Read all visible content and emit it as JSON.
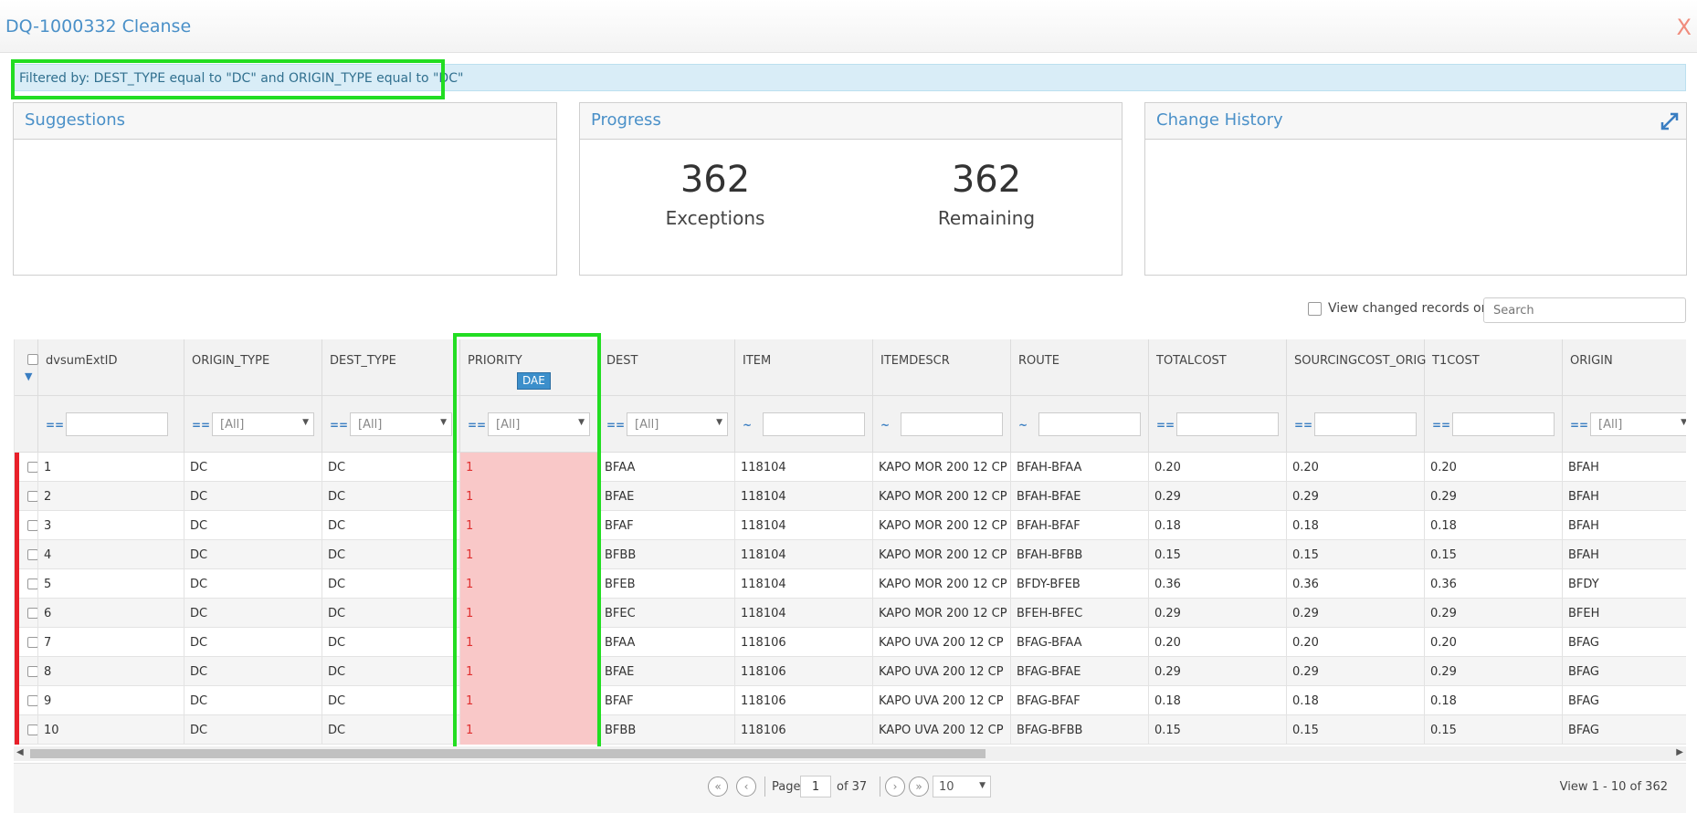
{
  "window": {
    "title": "DQ-1000332 Cleanse",
    "close_label": "X"
  },
  "filter": {
    "text": "Filtered by: DEST_TYPE equal to \"DC\" and ORIGIN_TYPE equal to \"DC\""
  },
  "panels": {
    "suggestions": {
      "title": "Suggestions"
    },
    "progress": {
      "title": "Progress",
      "exceptions_value": "362",
      "exceptions_label": "Exceptions",
      "remaining_value": "362",
      "remaining_label": "Remaining"
    },
    "history": {
      "title": "Change History"
    }
  },
  "toolbar": {
    "view_changed_label": "View changed records only",
    "search_placeholder": "Search"
  },
  "grid": {
    "columns": [
      "dvsumExtID",
      "ORIGIN_TYPE",
      "DEST_TYPE",
      "PRIORITY",
      "DEST",
      "ITEM",
      "ITEMDESCR",
      "ROUTE",
      "TOTALCOST",
      "SOURCINGCOST_ORIG",
      "T1COST",
      "ORIGIN"
    ],
    "priority_badge": "DAE",
    "filters": [
      {
        "op": "==",
        "type": "text",
        "value": ""
      },
      {
        "op": "==",
        "type": "select",
        "value": "[All]"
      },
      {
        "op": "==",
        "type": "select",
        "value": "[All]"
      },
      {
        "op": "==",
        "type": "select",
        "value": "[All]"
      },
      {
        "op": "==",
        "type": "select",
        "value": "[All]"
      },
      {
        "op": "~",
        "type": "text",
        "value": ""
      },
      {
        "op": "~",
        "type": "text",
        "value": ""
      },
      {
        "op": "~",
        "type": "text",
        "value": ""
      },
      {
        "op": "==",
        "type": "text",
        "value": ""
      },
      {
        "op": "==",
        "type": "text",
        "value": ""
      },
      {
        "op": "==",
        "type": "text",
        "value": ""
      },
      {
        "op": "==",
        "type": "select",
        "value": "[All]"
      }
    ],
    "rows": [
      [
        "1",
        "DC",
        "DC",
        "1",
        "BFAA",
        "118104",
        "KAPO MOR 200 12 CP",
        "BFAH-BFAA",
        "0.20",
        "0.20",
        "0.20",
        "BFAH"
      ],
      [
        "2",
        "DC",
        "DC",
        "1",
        "BFAE",
        "118104",
        "KAPO MOR 200 12 CP",
        "BFAH-BFAE",
        "0.29",
        "0.29",
        "0.29",
        "BFAH"
      ],
      [
        "3",
        "DC",
        "DC",
        "1",
        "BFAF",
        "118104",
        "KAPO MOR 200 12 CP",
        "BFAH-BFAF",
        "0.18",
        "0.18",
        "0.18",
        "BFAH"
      ],
      [
        "4",
        "DC",
        "DC",
        "1",
        "BFBB",
        "118104",
        "KAPO MOR 200 12 CP",
        "BFAH-BFBB",
        "0.15",
        "0.15",
        "0.15",
        "BFAH"
      ],
      [
        "5",
        "DC",
        "DC",
        "1",
        "BFEB",
        "118104",
        "KAPO MOR 200 12 CP",
        "BFDY-BFEB",
        "0.36",
        "0.36",
        "0.36",
        "BFDY"
      ],
      [
        "6",
        "DC",
        "DC",
        "1",
        "BFEC",
        "118104",
        "KAPO MOR 200 12 CP",
        "BFEH-BFEC",
        "0.29",
        "0.29",
        "0.29",
        "BFEH"
      ],
      [
        "7",
        "DC",
        "DC",
        "1",
        "BFAA",
        "118106",
        "KAPO UVA 200 12 CP",
        "BFAG-BFAA",
        "0.20",
        "0.20",
        "0.20",
        "BFAG"
      ],
      [
        "8",
        "DC",
        "DC",
        "1",
        "BFAE",
        "118106",
        "KAPO UVA 200 12 CP",
        "BFAG-BFAE",
        "0.29",
        "0.29",
        "0.29",
        "BFAG"
      ],
      [
        "9",
        "DC",
        "DC",
        "1",
        "BFAF",
        "118106",
        "KAPO UVA 200 12 CP",
        "BFAG-BFAF",
        "0.18",
        "0.18",
        "0.18",
        "BFAG"
      ],
      [
        "10",
        "DC",
        "DC",
        "1",
        "BFBB",
        "118106",
        "KAPO UVA 200 12 CP",
        "BFAG-BFBB",
        "0.15",
        "0.15",
        "0.15",
        "BFAG"
      ]
    ]
  },
  "pager": {
    "page_label": "Page",
    "page_value": "1",
    "of_label": "of 37",
    "page_size": "10",
    "view_label": "View 1 - 10 of 362"
  },
  "colors": {
    "accent": "#4a90c8",
    "error_row": "#e8202a",
    "priority_cell": "#f9c8c8",
    "highlight": "#22dd22"
  }
}
